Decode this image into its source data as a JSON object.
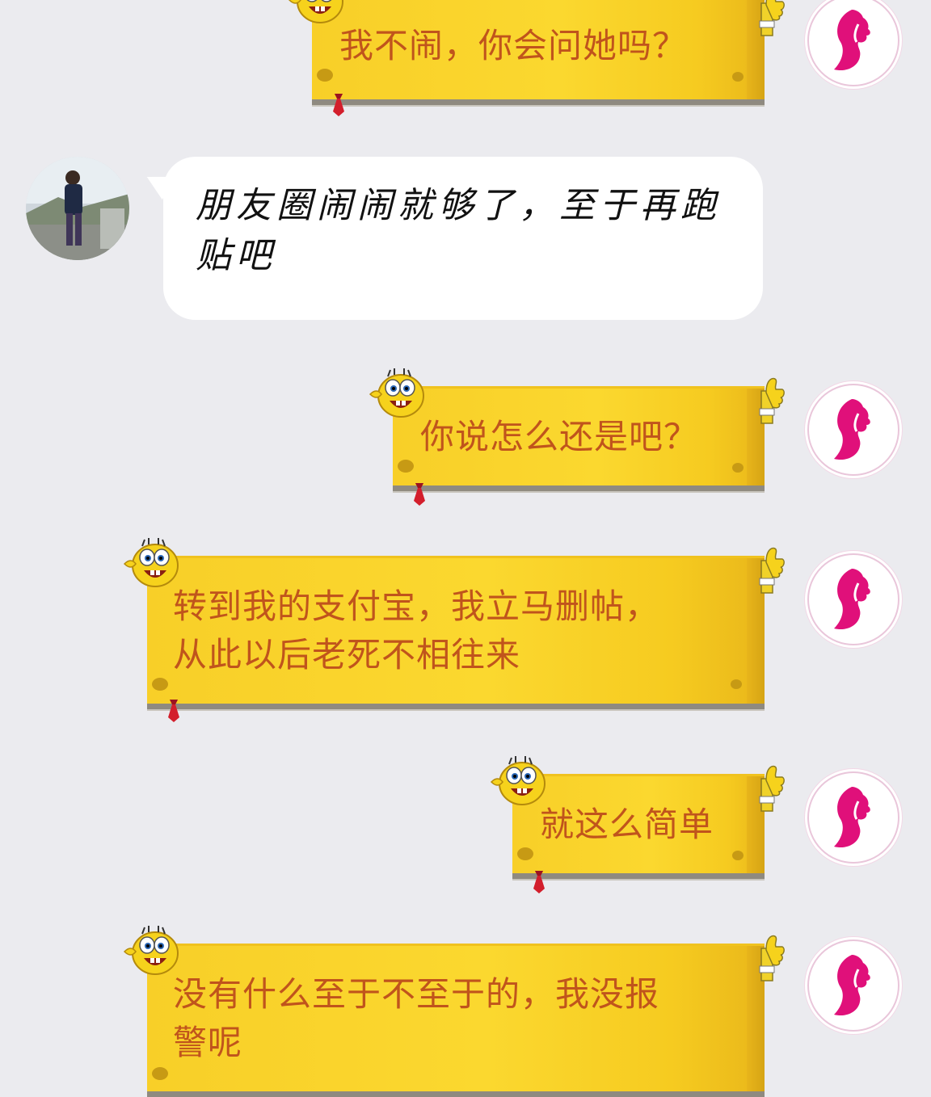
{
  "messages": [
    {
      "id": 1,
      "sender": "me",
      "text": "我不闹，你会问她吗？"
    },
    {
      "id": 2,
      "sender": "friend",
      "text": "朋友圈闹闹就够了，至于再跑\n贴吧"
    },
    {
      "id": 3,
      "sender": "me",
      "text": "你说怎么还是吧？"
    },
    {
      "id": 4,
      "sender": "me",
      "text": "转到我的支付宝，我立马删帖，\n从此以后老死不相往来"
    },
    {
      "id": 5,
      "sender": "me",
      "text": "就这么简单"
    },
    {
      "id": 6,
      "sender": "me",
      "text": "没有什么至于不至于的，我没报\n警呢"
    }
  ],
  "icons": {
    "me_avatar": "pink-woman-profile-logo-icon",
    "friend_avatar": "man-standing-photo-avatar",
    "bubble_mascot": "sponge-face-icon",
    "bubble_thumb": "thumbs-up-icon",
    "bubble_tie": "red-tie-icon"
  },
  "colors": {
    "background": "#ebebef",
    "sponge_bubble": "#fbd82f",
    "sponge_text": "#c0541c",
    "logo_pink": "#e0107a",
    "white_bubble": "#ffffff"
  }
}
